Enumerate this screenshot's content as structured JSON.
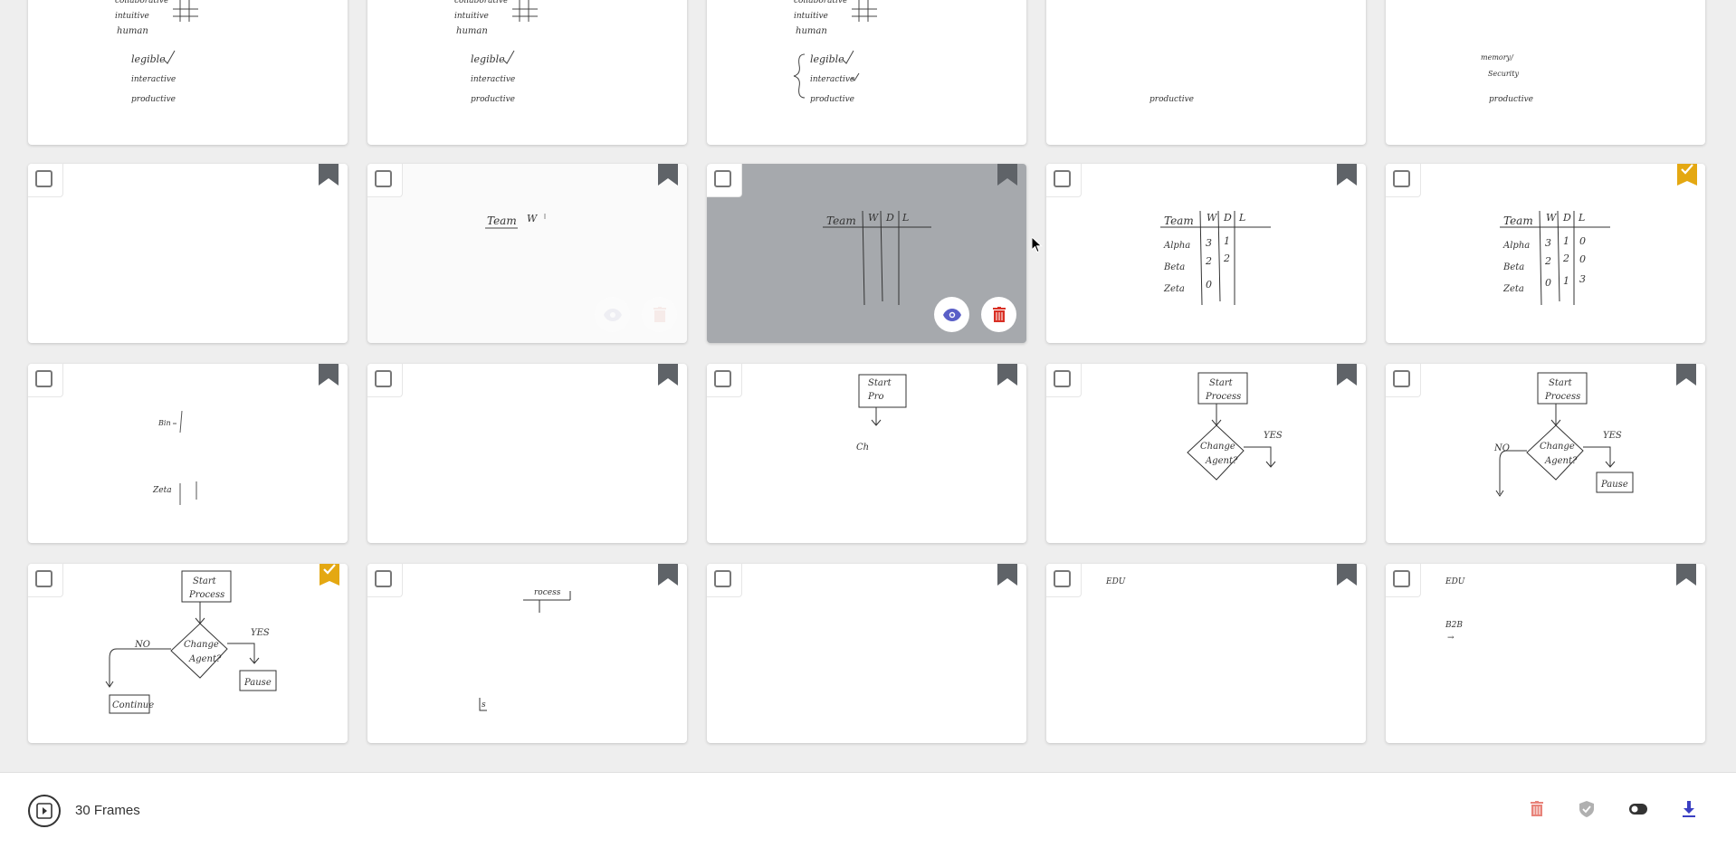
{
  "footer": {
    "frames_label": "30 Frames"
  },
  "colors": {
    "accent": "#5a5fc7",
    "danger": "#d93025",
    "bookmark_active": "#e4a812",
    "bookmark_inactive": "#5f6368",
    "hover_overlay": "#a6a9ad"
  },
  "frames": {
    "row1": [
      {
        "sketch_text": [
          "collaborative",
          "intuitive",
          "human",
          "legible",
          "interactive",
          "productive"
        ]
      },
      {
        "sketch_text": [
          "collaborative",
          "intuitive",
          "human",
          "legible",
          "interactive",
          "productive"
        ]
      },
      {
        "sketch_text": [
          "collaborative",
          "intuitive",
          "human",
          "legible",
          "interactive",
          "productive"
        ]
      },
      {
        "sketch_text": [
          "productive"
        ]
      },
      {
        "sketch_text": [
          "memory/",
          "Security",
          "productive"
        ]
      }
    ],
    "row2": [
      {
        "sketch_text": []
      },
      {
        "sketch_text": [
          "Team",
          "W"
        ]
      },
      {
        "sketch_text": [
          "Team",
          "W",
          "D",
          "L"
        ]
      },
      {
        "sketch_text": [
          "Team",
          "W",
          "D",
          "L",
          "Alpha",
          "Beta",
          "Zeta",
          "3",
          "1",
          "2",
          "2",
          "0"
        ]
      },
      {
        "sketch_text": [
          "Team",
          "W",
          "D",
          "L",
          "Alpha",
          "Beta",
          "Zeta",
          "3",
          "1",
          "0",
          "2",
          "2",
          "0",
          "0",
          "1",
          "3"
        ]
      }
    ],
    "row3": [
      {
        "sketch_text": [
          "Bin",
          "Zeta"
        ]
      },
      {
        "sketch_text": []
      },
      {
        "sketch_text": [
          "Start",
          "Pro",
          "Ch"
        ]
      },
      {
        "sketch_text": [
          "Start",
          "Process",
          "Change",
          "Agent?",
          "YES"
        ]
      },
      {
        "sketch_text": [
          "Start",
          "Process",
          "Change",
          "Agent?",
          "YES",
          "NO",
          "Pause"
        ]
      }
    ],
    "row4": [
      {
        "sketch_text": [
          "Start",
          "Process",
          "Change",
          "Agent?",
          "YES",
          "NO",
          "Pause",
          "Continue"
        ]
      },
      {
        "sketch_text": [
          "rocess",
          "s"
        ]
      },
      {
        "sketch_text": []
      },
      {
        "sketch_text": [
          "EDU"
        ]
      },
      {
        "sketch_text": [
          "EDU",
          "B2B",
          "→"
        ]
      }
    ]
  }
}
